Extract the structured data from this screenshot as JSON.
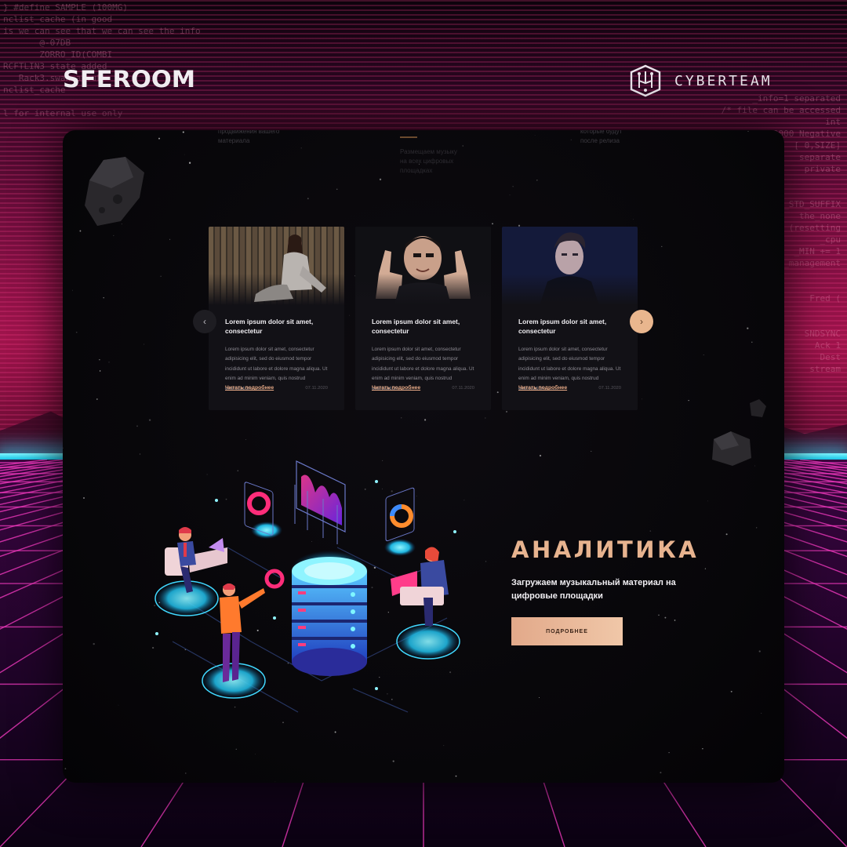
{
  "background": {
    "code_left": [
      "} #define SAMPLE (100MG)",
      "nclist_cache (in good",
      "is we can see that we can see the info",
      "       @-07DB",
      "       ZORRO_ID(COMBI",
      "RCFTLIN3 state added",
      "   Rack3.swan.ac.uk>",
      "nclist_cache",
      "",
      "l for internal use only"
    ],
    "code_right": [
      "_info=1 separated",
      "/* file can be accessed",
      "int",
      "* Feb 24, 2000 Negative",
      "[ 0,SIZE]",
      "separate",
      "private",
      "",
      "",
      "_PROC_STD_SUFFIX",
      "the_none",
      "(resetting",
      "_cpu",
      "_MIN += 1",
      "_management",
      "",
      "",
      "Fred (",
      "",
      "",
      "SNDSYNC",
      "Ack 1",
      "Dest",
      "stream"
    ]
  },
  "header": {
    "brand_left": "SFEROOM",
    "brand_right": "CYBERTEAM"
  },
  "site": {
    "top_fragments": {
      "col1": [
        "продвижения вашего",
        "материала"
      ],
      "col2": [
        "Размещаем музыку",
        "на всех цифровых",
        "площадках"
      ],
      "col3": [
        "которые будут",
        "после релиза"
      ]
    },
    "cards": [
      {
        "title": "Lorem ipsum dolor sit amet, consectetur",
        "text": "Lorem ipsum dolor sit amet, consectetur adipisicing elit, sed do eiusmod tempor incididunt ut labore et dolore magna aliqua. Ut enim ad minim veniam, quis nostrud exercitation .........",
        "link": "Читать подробнее",
        "date": "07.11.2020"
      },
      {
        "title": "Lorem ipsum dolor sit amet, consectetur",
        "text": "Lorem ipsum dolor sit amet, consectetur adipisicing elit, sed do eiusmod tempor incididunt ut labore et dolore magna aliqua. Ut enim ad minim veniam, quis nostrud exercitation .........",
        "link": "Читать подробнее",
        "date": "07.11.2020"
      },
      {
        "title": "Lorem ipsum dolor sit amet, consectetur",
        "text": "Lorem ipsum dolor sit amet, consectetur adipisicing elit, sed do eiusmod tempor incididunt ut labore et dolore magna aliqua. Ut enim ad minim veniam, quis nostrud exercitation .........",
        "link": "Читать подробнее",
        "date": "07.11.2020"
      }
    ],
    "nav": {
      "prev_icon": "chevron-left-icon",
      "prev": "‹",
      "next_icon": "chevron-right-icon",
      "next": "›"
    },
    "analytics": {
      "title": "АНАЛИТИКА",
      "subtitle": "Загружаем музыкальный материал на цифровые площадки",
      "button": "ПОДРОБНЕЕ"
    }
  },
  "colors": {
    "accent": "#e7b38f",
    "panel_bg": "#070609",
    "card_bg": "#121116",
    "neon_pink": "#ff2d7a",
    "neon_cyan": "#3ce0ff"
  }
}
